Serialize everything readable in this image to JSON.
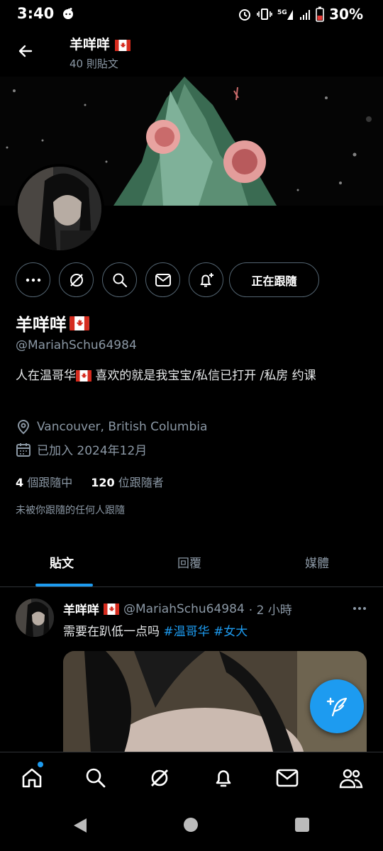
{
  "status_bar": {
    "time": "3:40",
    "battery": "30%",
    "icons": [
      "reddit-icon",
      "alarm-icon",
      "vibrate-icon",
      "signal-5g-icon",
      "wifi-signal-icon",
      "battery-icon"
    ]
  },
  "header": {
    "name": "羊咩咩",
    "post_count": "40 則貼文"
  },
  "profile": {
    "name": "羊咩咩",
    "handle": "@MariahSchu64984",
    "follow_button": "正在跟隨",
    "bio_part1": "人在温哥华",
    "bio_part2": " 喜欢的就是我宝宝/私信已打开 /私房 约课",
    "location": "Vancouver, British Columbia",
    "joined": "已加入 2024年12月",
    "following_count": "4",
    "following_label": "個跟隨中",
    "followers_count": "120",
    "followers_label": "位跟隨者",
    "not_followed_note": "未被你跟隨的任何人跟隨"
  },
  "tabs": [
    {
      "label": "貼文",
      "active": true
    },
    {
      "label": "回覆",
      "active": false
    },
    {
      "label": "媒體",
      "active": false
    }
  ],
  "tweet": {
    "name": "羊咩咩",
    "handle": "@MariahSchu64984",
    "time": "· 2 小時",
    "text": "需要在趴低一点吗 ",
    "tag1": "#温哥华",
    "tag2": " #女大"
  },
  "bottom_nav": [
    "home-icon",
    "search-icon",
    "grok-icon",
    "notifications-icon",
    "messages-icon",
    "communities-icon"
  ],
  "colors": {
    "accent": "#1d9bf0",
    "background": "#000000",
    "text_secondary": "#8b98a5",
    "border": "#536471"
  }
}
